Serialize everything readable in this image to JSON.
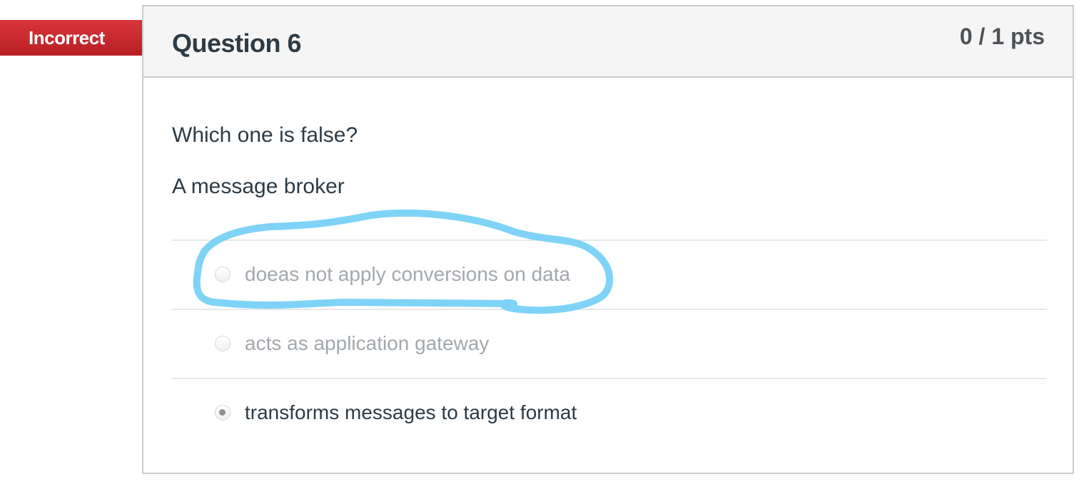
{
  "status": {
    "label": "Incorrect",
    "color": "#c8262b"
  },
  "question": {
    "title": "Question 6",
    "points": "0 / 1 pts",
    "prompt": "Which one is false?",
    "stem": "A message broker"
  },
  "answers": [
    {
      "label": "doeas not apply conversions on data",
      "selected": false
    },
    {
      "label": "acts as application gateway",
      "selected": false
    },
    {
      "label": "transforms messages to target format",
      "selected": true
    }
  ],
  "annotation": {
    "color": "#7fd3f7",
    "circled_answer": "doeas not apply conversions on data"
  }
}
